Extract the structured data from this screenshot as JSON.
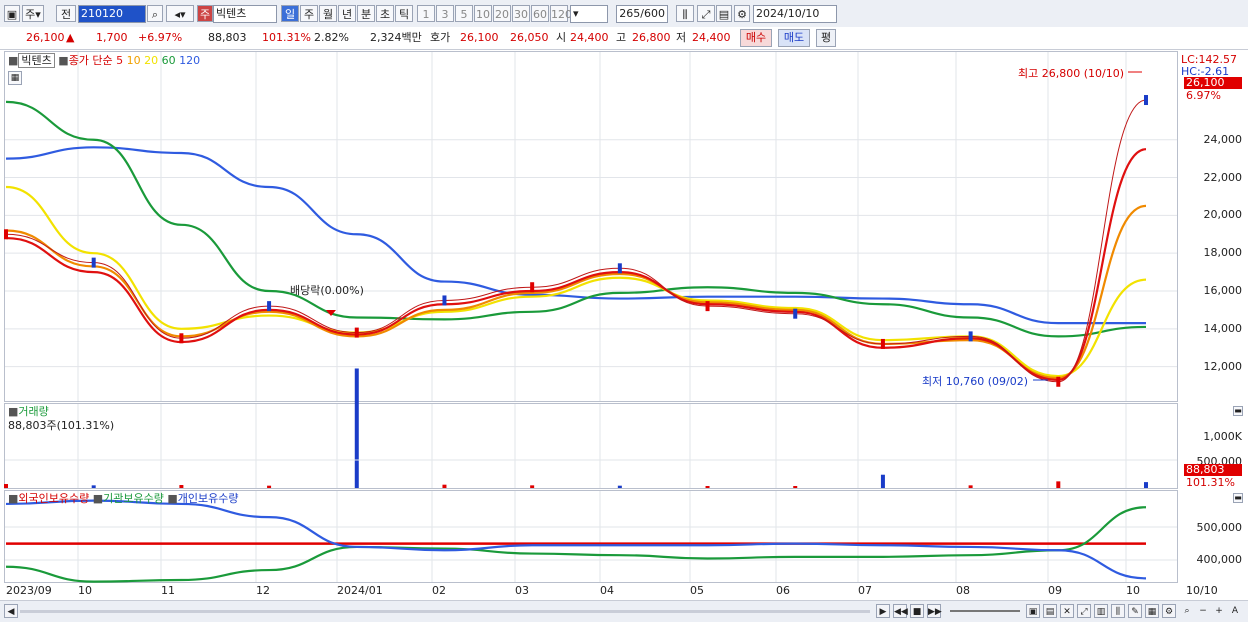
{
  "toolbar": {
    "type_label": "주",
    "prev_label": "전",
    "code": "210120",
    "stock_tag": "주",
    "stock_name": "빅텐츠",
    "periods": [
      "일",
      "주",
      "월",
      "년",
      "분",
      "초",
      "틱"
    ],
    "selected_period": "일",
    "ranges": [
      "1",
      "3",
      "5",
      "10",
      "20",
      "30",
      "60",
      "120"
    ],
    "count": "265",
    "count_total": "/600",
    "date": "2024/10/10"
  },
  "quote": {
    "price": "26,100",
    "change_arrow": "▲",
    "change": "1,700",
    "change_pct": "+6.97%",
    "volume": "88,803",
    "volume_pct": "101.31%",
    "turnover_pct": "2.82%",
    "amount": "2,324백만",
    "bid_label": "호가",
    "ask": "26,100",
    "bid": "26,050",
    "open_label": "시",
    "open": "24,400",
    "high_label": "고",
    "high": "26,800",
    "low_label": "저",
    "low": "24,400",
    "buy_label": "매수",
    "sell_label": "매도",
    "eval_label": "평"
  },
  "price_panel": {
    "legend_name": "빅텐츠",
    "legend_close": "종가 단순",
    "ma_labels": [
      "5",
      "10",
      "20",
      "60",
      "120"
    ],
    "ma_colors": [
      "#e01010",
      "#f0a000",
      "#f2e200",
      "#1a9a3a",
      "#2f5be0"
    ],
    "lc_label": "LC:142.57",
    "hc_label": "HC:-2.61",
    "price_tag": "26,100",
    "pct_tag": "6.97%",
    "max_note": "최고 26,800 (10/10)",
    "min_note": "최저 10,760 (09/02)",
    "dividend_note": "배당락(0.00%)",
    "y_ticks": [
      "24,000",
      "22,000",
      "20,000",
      "18,000",
      "16,000",
      "14,000",
      "12,000"
    ]
  },
  "volume_panel": {
    "title": "거래량",
    "value_label": "88,803주(101.31%)",
    "y_ticks": [
      "1,000K",
      "500,000"
    ],
    "tag": "88,803",
    "tag2": "101.31%"
  },
  "holding_panel": {
    "legends": [
      "외국인보유수량",
      "기관보유수량",
      "개인보유수량"
    ],
    "y_ticks": [
      "500,000",
      "400,000"
    ]
  },
  "x_labels": [
    "2023/09",
    "10",
    "11",
    "12",
    "2024/01",
    "02",
    "03",
    "04",
    "05",
    "06",
    "07",
    "08",
    "09",
    "10",
    "10/10"
  ],
  "colors": {
    "up": "#e00000",
    "down": "#1a3cc8",
    "accent": "#3b6fd8"
  },
  "chart_data": [
    {
      "type": "line",
      "title": "",
      "x": [
        "2023/09",
        "10",
        "11",
        "12",
        "2024/01",
        "02",
        "03",
        "04",
        "05",
        "06",
        "07",
        "08",
        "09",
        "10"
      ],
      "series": [
        {
          "name": "종가",
          "values": [
            19000,
            17500,
            13500,
            15200,
            13800,
            15500,
            16200,
            17200,
            15200,
            14800,
            13200,
            13600,
            11200,
            26100
          ]
        },
        {
          "name": "5",
          "values": [
            18800,
            17000,
            13300,
            15000,
            13700,
            15300,
            16000,
            17000,
            15300,
            14900,
            13000,
            13500,
            11300,
            23500
          ]
        },
        {
          "name": "10",
          "values": [
            19200,
            17300,
            13600,
            14900,
            13600,
            15000,
            15900,
            16900,
            15400,
            15000,
            13200,
            13400,
            11400,
            20500
          ]
        },
        {
          "name": "20",
          "values": [
            21500,
            18000,
            14000,
            14700,
            13800,
            14900,
            15700,
            16700,
            15500,
            15100,
            13400,
            13600,
            11500,
            16600
          ]
        },
        {
          "name": "60",
          "values": [
            26000,
            24000,
            19500,
            16000,
            14600,
            14500,
            14900,
            15900,
            16200,
            15900,
            15300,
            14600,
            13600,
            14100
          ]
        },
        {
          "name": "120",
          "values": [
            23000,
            23600,
            23300,
            21500,
            19000,
            16500,
            15800,
            15600,
            15700,
            15700,
            15600,
            15300,
            14300,
            14300
          ]
        }
      ],
      "ylim": [
        10500,
        27000
      ]
    },
    {
      "type": "bar",
      "title": "거래량",
      "x": [
        "2023/09",
        "10",
        "11",
        "12",
        "2024/01",
        "02",
        "03",
        "04",
        "05",
        "06",
        "07",
        "08",
        "09",
        "10"
      ],
      "values": [
        60000,
        40000,
        45000,
        35000,
        1800000,
        50000,
        40000,
        35000,
        30000,
        30000,
        200000,
        40000,
        100000,
        88803
      ],
      "ylim": [
        0,
        1250000
      ]
    },
    {
      "type": "line",
      "title": "",
      "x": [
        "2023/09",
        "10",
        "11",
        "12",
        "2024/01",
        "02",
        "03",
        "04",
        "05",
        "06",
        "07",
        "08",
        "09",
        "10"
      ],
      "series": [
        {
          "name": "외국인보유수량",
          "values": [
            460000,
            460000,
            460000,
            460000,
            460000,
            460000,
            460000,
            460000,
            460000,
            460000,
            460000,
            460000,
            460000,
            460000
          ]
        },
        {
          "name": "기관보유수량",
          "values": [
            390000,
            345000,
            350000,
            380000,
            450000,
            445000,
            430000,
            425000,
            415000,
            420000,
            420000,
            425000,
            440000,
            570000
          ]
        },
        {
          "name": "개인보유수량",
          "values": [
            580000,
            590000,
            580000,
            540000,
            450000,
            440000,
            455000,
            455000,
            455000,
            460000,
            455000,
            450000,
            440000,
            355000
          ]
        }
      ],
      "ylim": [
        350000,
        610000
      ]
    }
  ]
}
